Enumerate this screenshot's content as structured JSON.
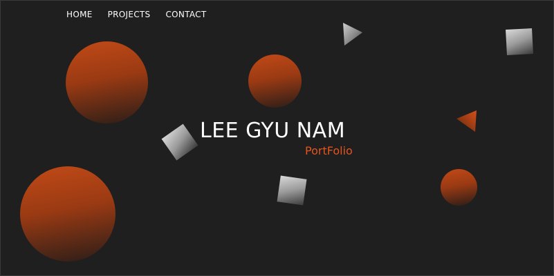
{
  "nav": {
    "items": [
      {
        "label": "HOME"
      },
      {
        "label": "PROJECTS"
      },
      {
        "label": "CONTACT"
      }
    ]
  },
  "hero": {
    "title": "LEE GYU NAM",
    "subtitle": "PortFolio"
  },
  "colors": {
    "background": "#1f1f1f",
    "accent": "#e3541f",
    "nav_text": "#ffffff",
    "circle_top": "#c24a17",
    "square_top": "#d9d9d9"
  }
}
